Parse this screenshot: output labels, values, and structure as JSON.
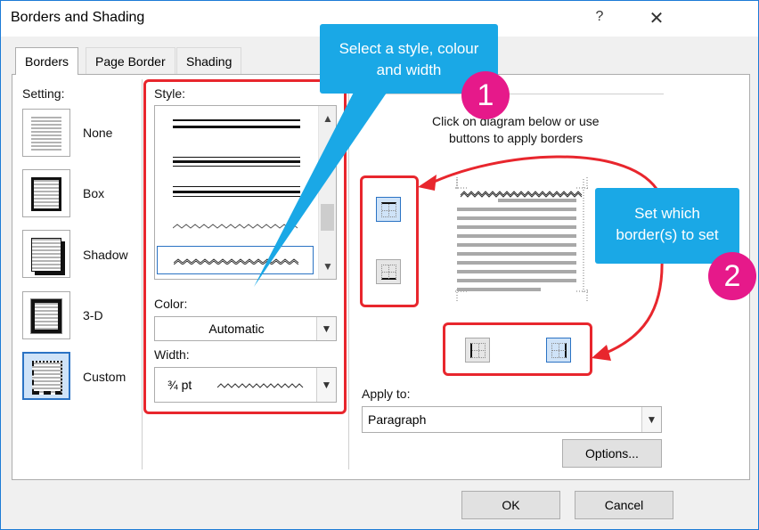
{
  "window": {
    "title": "Borders and Shading",
    "help_label": "?",
    "close_label": "✕"
  },
  "tabs": [
    {
      "label": "Borders",
      "active": true
    },
    {
      "label": "Page Border",
      "active": false
    },
    {
      "label": "Shading",
      "active": false
    }
  ],
  "setting": {
    "heading": "Setting:",
    "items": [
      {
        "label": "None",
        "icon": "none-setting-icon"
      },
      {
        "label": "Box",
        "icon": "box-setting-icon"
      },
      {
        "label": "Shadow",
        "icon": "shadow-setting-icon"
      },
      {
        "label": "3-D",
        "icon": "3d-setting-icon"
      },
      {
        "label": "Custom",
        "icon": "custom-setting-icon",
        "selected": true
      }
    ]
  },
  "style": {
    "heading": "Style:",
    "selected": "wavy"
  },
  "color": {
    "heading": "Color:",
    "value": "Automatic"
  },
  "width": {
    "heading": "Width:",
    "value": "¾ pt"
  },
  "preview": {
    "instruction_line1": "Click on diagram below or use",
    "instruction_line2": "buttons to apply borders"
  },
  "apply_to": {
    "heading": "Apply to:",
    "value": "Paragraph"
  },
  "buttons": {
    "options": "Options...",
    "ok": "OK",
    "cancel": "Cancel"
  },
  "callouts": {
    "one_line1": "Select a style, colour",
    "one_line2": "and width",
    "one_number": "1",
    "two_line1": "Set which",
    "two_line2": "border(s)  to set",
    "two_number": "2"
  },
  "colors": {
    "callout": "#1aa8e6",
    "badge": "#e6198a",
    "highlight_box": "#e8262d",
    "selection": "#2b73c4"
  }
}
